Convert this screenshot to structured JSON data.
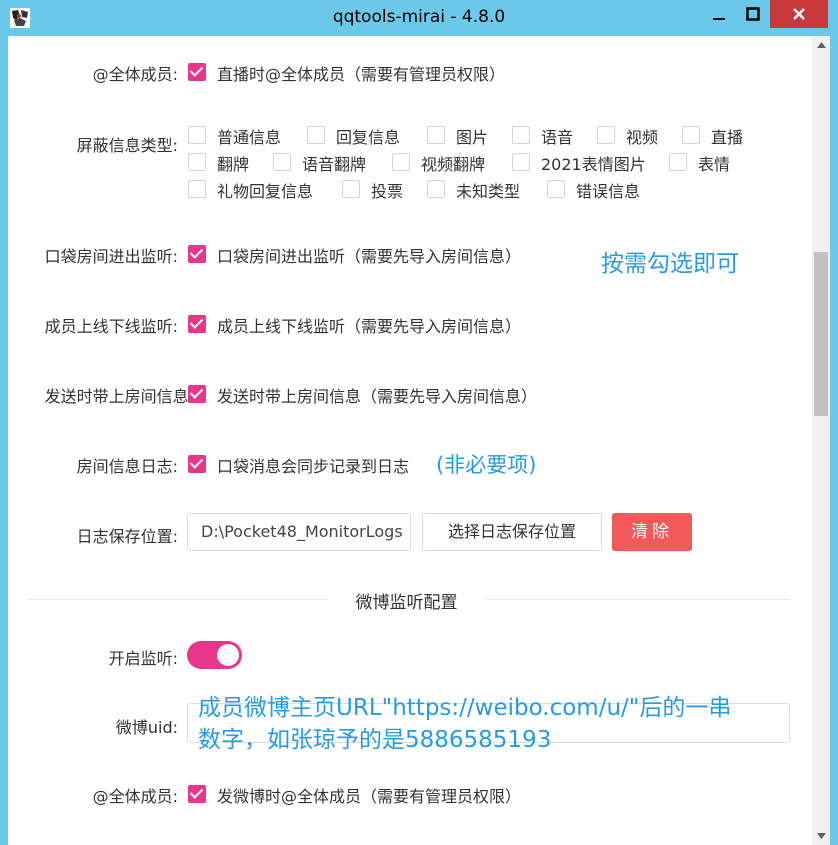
{
  "window": {
    "title": "qqtools-mirai - 4.8.0",
    "accent": "#e8368a",
    "titlebar_color": "#6bc8e8",
    "close_color": "#c7393a"
  },
  "live_at_all": {
    "label": "@全体成员:",
    "checkbox_text": "直播时@全体成员（需要有管理员权限）",
    "checked": true
  },
  "block_types": {
    "label": "屏蔽信息类型:",
    "items": [
      {
        "text": "普通信息",
        "checked": false
      },
      {
        "text": "回复信息",
        "checked": false
      },
      {
        "text": "图片",
        "checked": false
      },
      {
        "text": "语音",
        "checked": false
      },
      {
        "text": "视频",
        "checked": false
      },
      {
        "text": "直播",
        "checked": false
      },
      {
        "text": "翻牌",
        "checked": false
      },
      {
        "text": "语音翻牌",
        "checked": false
      },
      {
        "text": "视频翻牌",
        "checked": false
      },
      {
        "text": "2021表情图片",
        "checked": false
      },
      {
        "text": "表情",
        "checked": false
      },
      {
        "text": "礼物回复信息",
        "checked": false
      },
      {
        "text": "投票",
        "checked": false
      },
      {
        "text": "未知类型",
        "checked": false
      },
      {
        "text": "错误信息",
        "checked": false
      }
    ]
  },
  "room_enter_leave": {
    "label": "口袋房间进出监听:",
    "checkbox_text": "口袋房间进出监听（需要先导入房间信息）",
    "checked": true
  },
  "member_online": {
    "label": "成员上线下线监听:",
    "checkbox_text": "成员上线下线监听（需要先导入房间信息）",
    "checked": true
  },
  "send_room_info": {
    "label": "发送时带上房间信息:",
    "checkbox_text": "发送时带上房间信息（需要先导入房间信息）",
    "checked": true
  },
  "room_log": {
    "label": "房间信息日志:",
    "checkbox_text": "口袋消息会同步记录到日志",
    "checked": true
  },
  "log_path": {
    "label": "日志保存位置:",
    "value": "D:\\Pocket48_MonitorLogs",
    "choose_label": "选择日志保存位置",
    "clear_label": "清除"
  },
  "weibo_section": {
    "title": "微博监听配置",
    "enable_label": "开启监听:",
    "enabled": true,
    "uid_label": "微博uid:",
    "uid_value": "",
    "at_all_label": "@全体成员:",
    "at_all_text": "发微博时@全体成员（需要有管理员权限）",
    "at_all_checked": true
  },
  "annotations": {
    "select_note": "按需勾选即可",
    "optional_note": "(非必要项)",
    "uid_note_line1": "成员微博主页URL\"https://weibo.com/u/\"后的一串",
    "uid_note_line2": "数字，如张琼予的是5886585193",
    "note_color": "#2a9be0"
  }
}
